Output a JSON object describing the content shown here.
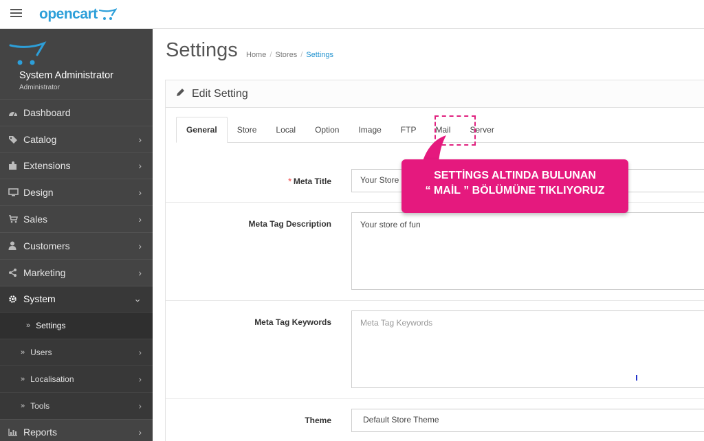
{
  "header": {
    "logo_text": "opencart",
    "menu_icon": "hamburger-icon",
    "brand_color": "#2d9fd9"
  },
  "sidebar": {
    "profile_name": "System Administrator",
    "profile_role": "Administrator",
    "items": [
      {
        "label": "Dashboard",
        "icon": "dashboard-icon"
      },
      {
        "label": "Catalog",
        "icon": "tags-icon"
      },
      {
        "label": "Extensions",
        "icon": "puzzle-icon"
      },
      {
        "label": "Design",
        "icon": "monitor-icon"
      },
      {
        "label": "Sales",
        "icon": "cart-icon"
      },
      {
        "label": "Customers",
        "icon": "user-icon"
      },
      {
        "label": "Marketing",
        "icon": "share-icon"
      },
      {
        "label": "System",
        "icon": "gear-icon"
      }
    ],
    "system_children": [
      {
        "label": "Settings"
      },
      {
        "label": "Users"
      },
      {
        "label": "Localisation"
      },
      {
        "label": "Tools"
      }
    ],
    "reports": {
      "label": "Reports",
      "icon": "bar-chart-icon"
    }
  },
  "main": {
    "title": "Settings",
    "breadcrumb": [
      "Home",
      "Stores",
      "Settings"
    ],
    "panel_title": "Edit Setting",
    "tabs": [
      "General",
      "Store",
      "Local",
      "Option",
      "Image",
      "FTP",
      "Mail",
      "Server"
    ],
    "active_tab": "General",
    "fields": {
      "meta_title": {
        "label": "Meta Title",
        "required": "*",
        "value": "Your Store"
      },
      "meta_description": {
        "label": "Meta Tag Description",
        "value": "Your store of fun"
      },
      "meta_keywords": {
        "label": "Meta Tag Keywords",
        "placeholder": "Meta Tag Keywords"
      },
      "theme": {
        "label": "Theme",
        "value": "Default Store Theme"
      }
    }
  },
  "annotation": {
    "line1": "SETTİNGS ALTINDA BULUNAN",
    "line2": "“ MAİL ” BÖLÜMÜNE TIKLIYORUZ",
    "color": "#e5197e"
  }
}
